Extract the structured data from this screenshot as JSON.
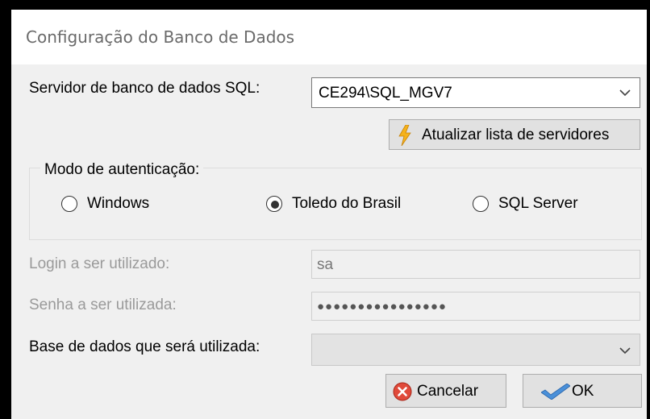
{
  "window": {
    "title": "Configuração do Banco de Dados"
  },
  "server": {
    "label": "Servidor de banco de dados SQL:",
    "value": "CE294\\SQL_MGV7",
    "refresh_button": "Atualizar lista de servidores"
  },
  "auth": {
    "group_label": "Modo de autenticação:",
    "options": [
      {
        "label": "Windows",
        "selected": false
      },
      {
        "label": "Toledo do Brasil",
        "selected": true
      },
      {
        "label": "SQL Server",
        "selected": false
      }
    ]
  },
  "login": {
    "label": "Login a ser utilizado:",
    "value": "sa"
  },
  "password": {
    "label": "Senha a ser utilizada:",
    "value": "●●●●●●●●●●●●●●●●"
  },
  "database": {
    "label": "Base de dados que será utilizada:",
    "value": ""
  },
  "buttons": {
    "cancel": "Cancelar",
    "ok": "OK"
  },
  "icons": {
    "refresh": "lightning-icon",
    "cancel": "cancel-x-icon",
    "ok": "checkmark-icon",
    "dropdown": "chevron-down-icon"
  },
  "colors": {
    "cancel_icon": "#e04a3a",
    "ok_icon": "#4a90d9",
    "lightning": "#f5b21b"
  }
}
